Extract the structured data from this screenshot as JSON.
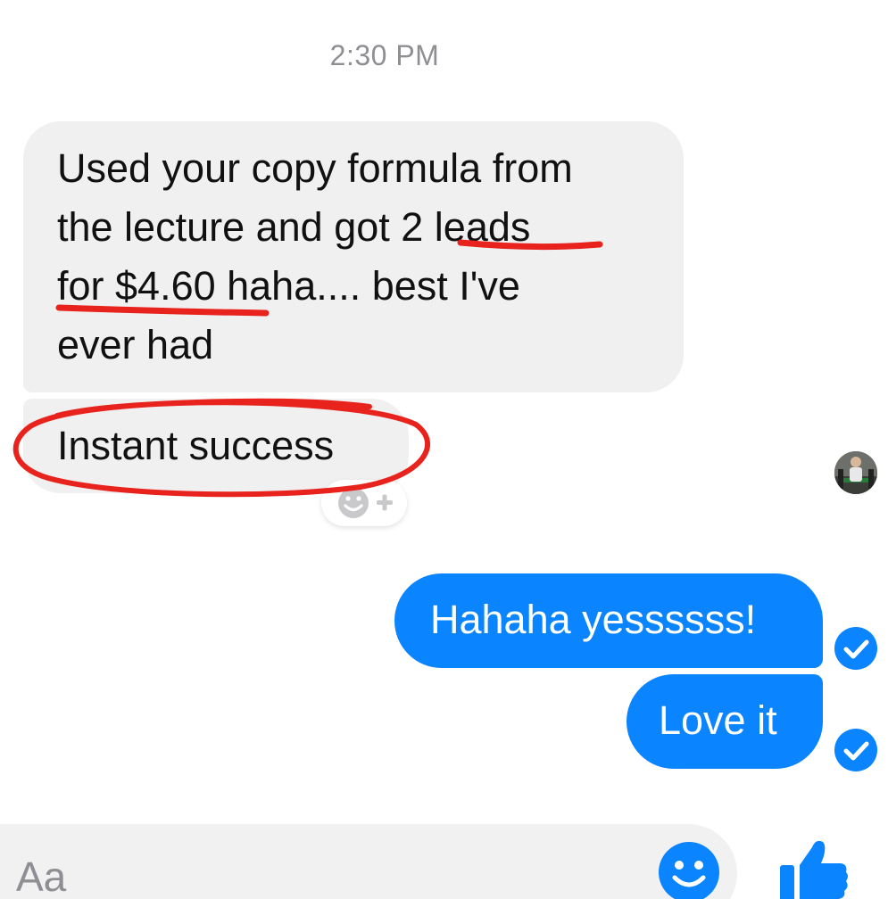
{
  "conversation": {
    "timestamp": "2:30 PM",
    "incoming": {
      "message1_lines": [
        "Used your copy formula from",
        "the lecture and got 2 leads",
        "for $4.60 haha.... best I've",
        "ever had"
      ],
      "message2": "Instant success"
    },
    "outgoing": {
      "message1": "Hahaha yessssss!",
      "message2": "Love it"
    }
  },
  "composer": {
    "placeholder": "Aa"
  },
  "icons": {
    "reaction": "add-reaction-icon",
    "read_receipt": "check-circle-icon",
    "emoji": "smiley-icon",
    "like": "thumbs-up-icon"
  },
  "colors": {
    "outgoing_bubble": "#0a84ff",
    "incoming_bubble": "#f1f0f0",
    "annotation": "#e8231d",
    "timestamp": "#8f8f93"
  }
}
